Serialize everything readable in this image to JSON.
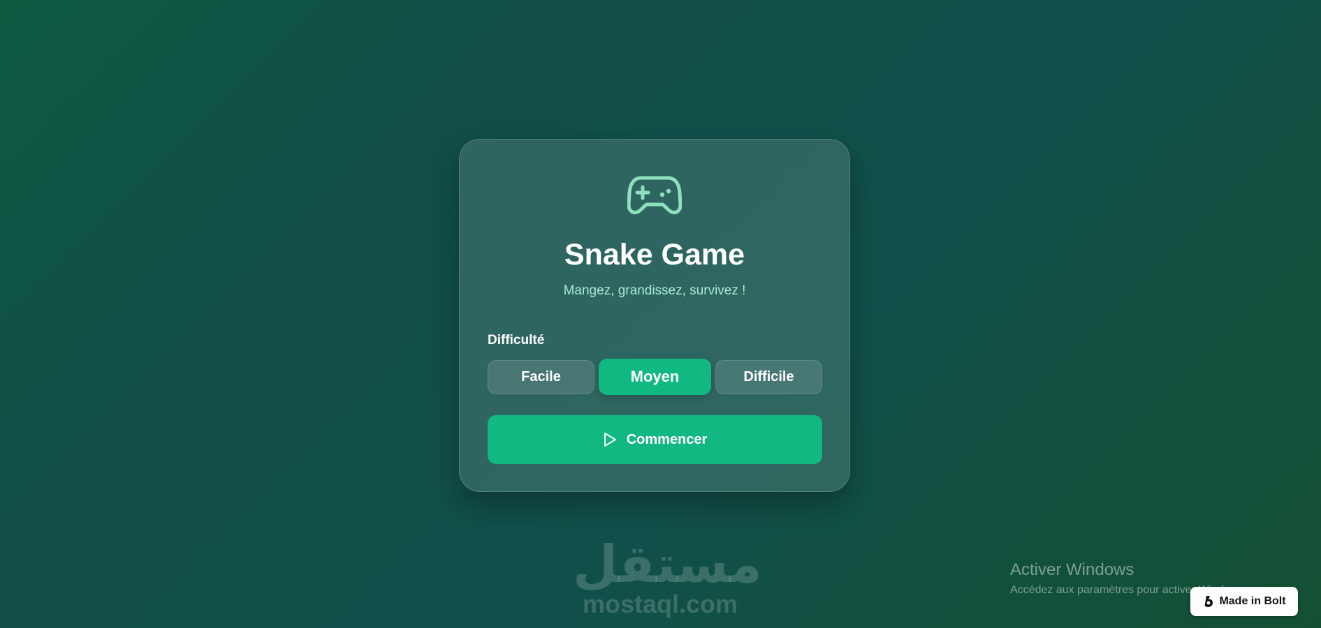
{
  "colors": {
    "accent": "#12b881",
    "icon": "#8ee0bf",
    "subtitle": "#a7ecd0",
    "background": "#0f5a43"
  },
  "card": {
    "logo_icon": "gamepad-icon",
    "title": "Snake Game",
    "subtitle": "Mangez, grandissez, survivez !",
    "difficulty": {
      "label": "Difficulté",
      "options": [
        "Facile",
        "Moyen",
        "Difficile"
      ],
      "selected": "Moyen"
    },
    "start_button": {
      "icon": "play-icon",
      "label": "Commencer"
    }
  },
  "watermark": {
    "arabic": "مستقل",
    "latin": "mostaql.com"
  },
  "windows_notice": {
    "title": "Activer Windows",
    "subtitle": "Accédez aux paramètres pour activer Windows."
  },
  "badge": {
    "icon": "bolt-logo-icon",
    "label": "Made in Bolt"
  }
}
